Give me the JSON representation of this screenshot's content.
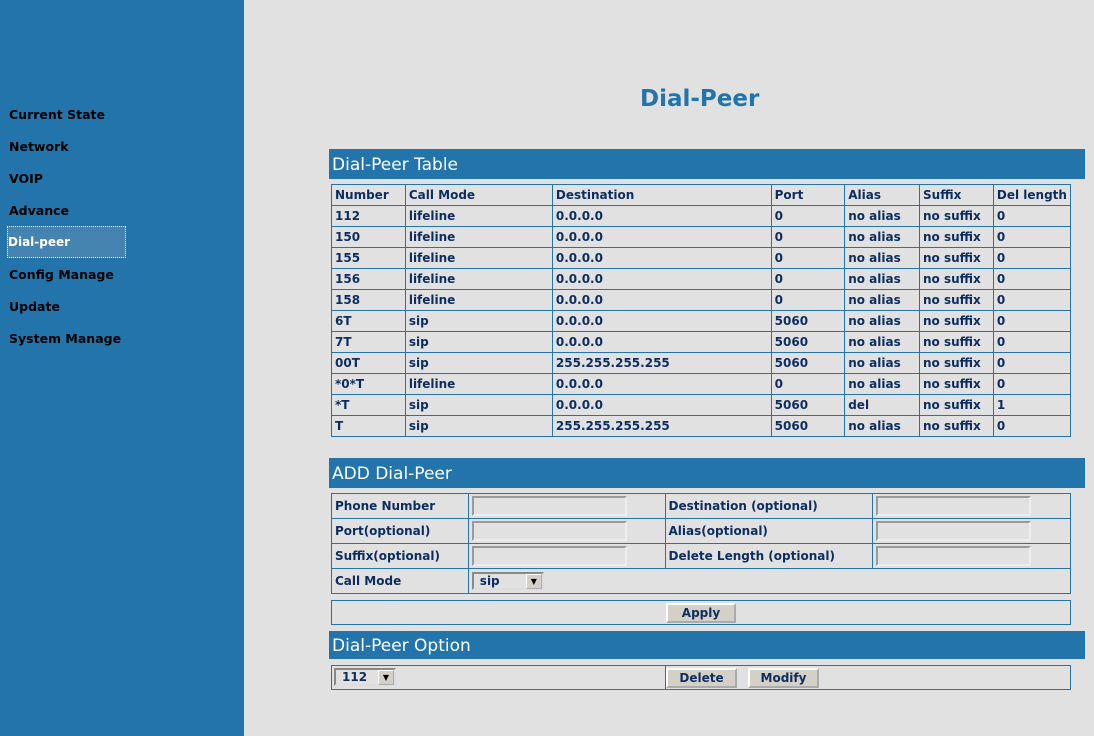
{
  "sidebar": {
    "items": [
      {
        "label": "Current State"
      },
      {
        "label": "Network"
      },
      {
        "label": "VOIP"
      },
      {
        "label": "Advance"
      },
      {
        "label": "Dial-peer"
      },
      {
        "label": "Config Manage"
      },
      {
        "label": "Update"
      },
      {
        "label": "System Manage"
      }
    ]
  },
  "page_title": "Dial-Peer",
  "table": {
    "title": "Dial-Peer Table",
    "columns": [
      "Number",
      "Call Mode",
      "Destination",
      "Port",
      "Alias",
      "Suffix",
      "Del length"
    ],
    "rows": [
      [
        "112",
        "lifeline",
        "0.0.0.0",
        "0",
        "no alias",
        "no suffix",
        "0"
      ],
      [
        "150",
        "lifeline",
        "0.0.0.0",
        "0",
        "no alias",
        "no suffix",
        "0"
      ],
      [
        "155",
        "lifeline",
        "0.0.0.0",
        "0",
        "no alias",
        "no suffix",
        "0"
      ],
      [
        "156",
        "lifeline",
        "0.0.0.0",
        "0",
        "no alias",
        "no suffix",
        "0"
      ],
      [
        "158",
        "lifeline",
        "0.0.0.0",
        "0",
        "no alias",
        "no suffix",
        "0"
      ],
      [
        "6T",
        "sip",
        "0.0.0.0",
        "5060",
        "no alias",
        "no suffix",
        "0"
      ],
      [
        "7T",
        "sip",
        "0.0.0.0",
        "5060",
        "no alias",
        "no suffix",
        "0"
      ],
      [
        "00T",
        "sip",
        "255.255.255.255",
        "5060",
        "no alias",
        "no suffix",
        "0"
      ],
      [
        "*0*T",
        "lifeline",
        "0.0.0.0",
        "0",
        "no alias",
        "no suffix",
        "0"
      ],
      [
        "*T",
        "sip",
        "0.0.0.0",
        "5060",
        "del",
        "no suffix",
        "1"
      ],
      [
        "T",
        "sip",
        "255.255.255.255",
        "5060",
        "no alias",
        "no suffix",
        "0"
      ]
    ]
  },
  "add": {
    "title": "ADD Dial-Peer",
    "phone_number": "Phone Number",
    "destination": "Destination (optional)",
    "port": "Port(optional)",
    "alias": "Alias(optional)",
    "suffix": "Suffix(optional)",
    "delete_length": "Delete Length (optional)",
    "call_mode": "Call Mode",
    "call_mode_value": "sip",
    "apply": "Apply"
  },
  "option": {
    "title": "Dial-Peer Option",
    "selected": "112",
    "delete": "Delete",
    "modify": "Modify"
  }
}
